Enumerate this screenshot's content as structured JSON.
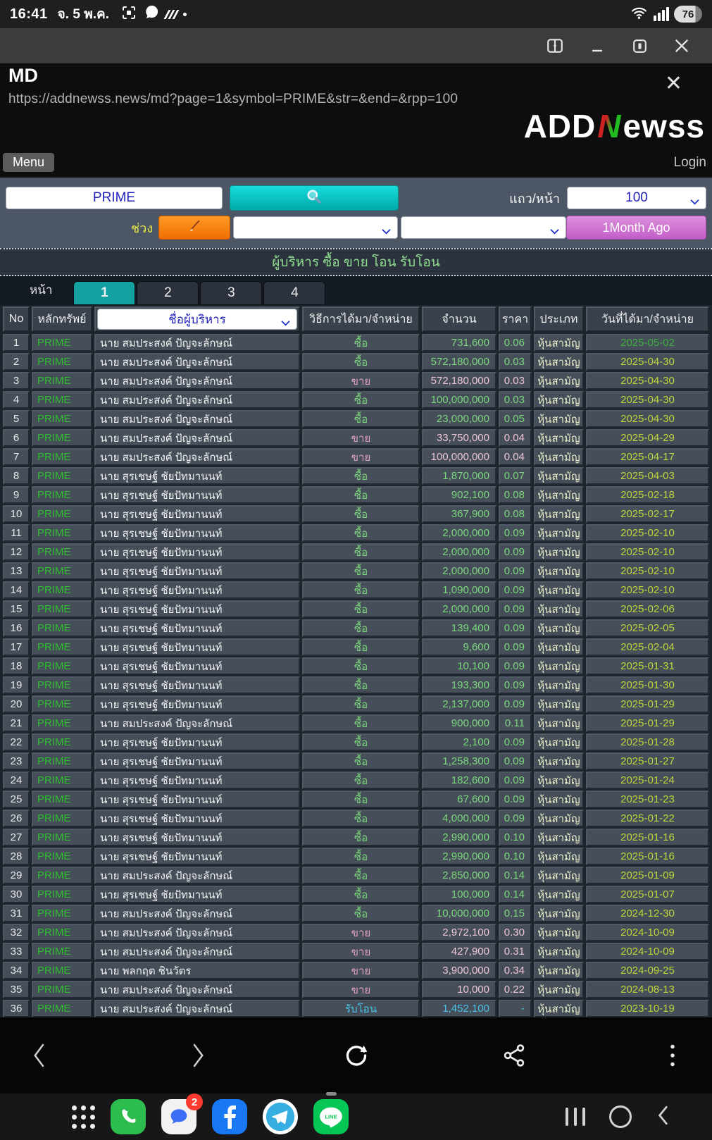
{
  "status_bar": {
    "time": "16:41",
    "date": "จ. 5 พ.ค.",
    "battery": "76"
  },
  "window": {
    "title": "MD",
    "url": "https://addnewss.news/md?page=1&symbol=PRIME&str=&end=&rpp=100"
  },
  "brand": {
    "logo_part1": "ADD",
    "logo_part2": "N",
    "logo_part3": "ewss",
    "menu": "Menu",
    "login": "Login"
  },
  "filters": {
    "symbol_value": "PRIME",
    "rows_per_page_label": "แถว/หน้า",
    "rows_per_page_value": "100",
    "range_label": "ช่วง",
    "month_button": "1Month Ago"
  },
  "table": {
    "title": "ผู้บริหาร ซื้อ ขาย โอน รับโอน",
    "page_label": "หน้า",
    "pages": [
      "1",
      "2",
      "3",
      "4"
    ],
    "active_index": 0,
    "headers": {
      "no": "No",
      "symbol": "หลักทรัพย์",
      "name": "ชื่อผู้บริหาร",
      "method": "วิธีการได้มา/จำหน่าย",
      "amount": "จำนวน",
      "price": "ราคา",
      "type": "ประเภท",
      "date": "วันที่ได้มา/จำหน่าย"
    },
    "rows": [
      {
        "no": "1",
        "symbol": "PRIME",
        "name": "นาย สมประสงค์ ปัญจะลักษณ์",
        "action": "ซื้อ",
        "side": "buy",
        "qty": "731,600",
        "price": "0.06",
        "type": "หุ้นสามัญ",
        "date": "2025-05-02",
        "hl": true
      },
      {
        "no": "2",
        "symbol": "PRIME",
        "name": "นาย สมประสงค์ ปัญจะลักษณ์",
        "action": "ซื้อ",
        "side": "buy",
        "qty": "572,180,000",
        "price": "0.03",
        "type": "หุ้นสามัญ",
        "date": "2025-04-30"
      },
      {
        "no": "3",
        "symbol": "PRIME",
        "name": "นาย สมประสงค์ ปัญจะลักษณ์",
        "action": "ขาย",
        "side": "sell",
        "qty": "572,180,000",
        "price": "0.03",
        "type": "หุ้นสามัญ",
        "date": "2025-04-30"
      },
      {
        "no": "4",
        "symbol": "PRIME",
        "name": "นาย สมประสงค์ ปัญจะลักษณ์",
        "action": "ซื้อ",
        "side": "buy",
        "qty": "100,000,000",
        "price": "0.03",
        "type": "หุ้นสามัญ",
        "date": "2025-04-30"
      },
      {
        "no": "5",
        "symbol": "PRIME",
        "name": "นาย สมประสงค์ ปัญจะลักษณ์",
        "action": "ซื้อ",
        "side": "buy",
        "qty": "23,000,000",
        "price": "0.05",
        "type": "หุ้นสามัญ",
        "date": "2025-04-30"
      },
      {
        "no": "6",
        "symbol": "PRIME",
        "name": "นาย สมประสงค์ ปัญจะลักษณ์",
        "action": "ขาย",
        "side": "sell",
        "qty": "33,750,000",
        "price": "0.04",
        "type": "หุ้นสามัญ",
        "date": "2025-04-29"
      },
      {
        "no": "7",
        "symbol": "PRIME",
        "name": "นาย สมประสงค์ ปัญจะลักษณ์",
        "action": "ขาย",
        "side": "sell",
        "qty": "100,000,000",
        "price": "0.04",
        "type": "หุ้นสามัญ",
        "date": "2025-04-17"
      },
      {
        "no": "8",
        "symbol": "PRIME",
        "name": "นาย สุรเชษฐ์ ชัยปัทมานนท์",
        "action": "ซื้อ",
        "side": "buy",
        "qty": "1,870,000",
        "price": "0.07",
        "type": "หุ้นสามัญ",
        "date": "2025-04-03"
      },
      {
        "no": "9",
        "symbol": "PRIME",
        "name": "นาย สุรเชษฐ์ ชัยปัทมานนท์",
        "action": "ซื้อ",
        "side": "buy",
        "qty": "902,100",
        "price": "0.08",
        "type": "หุ้นสามัญ",
        "date": "2025-02-18"
      },
      {
        "no": "10",
        "symbol": "PRIME",
        "name": "นาย สุรเชษฐ์ ชัยปัทมานนท์",
        "action": "ซื้อ",
        "side": "buy",
        "qty": "367,900",
        "price": "0.08",
        "type": "หุ้นสามัญ",
        "date": "2025-02-17"
      },
      {
        "no": "11",
        "symbol": "PRIME",
        "name": "นาย สุรเชษฐ์ ชัยปัทมานนท์",
        "action": "ซื้อ",
        "side": "buy",
        "qty": "2,000,000",
        "price": "0.09",
        "type": "หุ้นสามัญ",
        "date": "2025-02-10"
      },
      {
        "no": "12",
        "symbol": "PRIME",
        "name": "นาย สุรเชษฐ์ ชัยปัทมานนท์",
        "action": "ซื้อ",
        "side": "buy",
        "qty": "2,000,000",
        "price": "0.09",
        "type": "หุ้นสามัญ",
        "date": "2025-02-10"
      },
      {
        "no": "13",
        "symbol": "PRIME",
        "name": "นาย สุรเชษฐ์ ชัยปัทมานนท์",
        "action": "ซื้อ",
        "side": "buy",
        "qty": "2,000,000",
        "price": "0.09",
        "type": "หุ้นสามัญ",
        "date": "2025-02-10"
      },
      {
        "no": "14",
        "symbol": "PRIME",
        "name": "นาย สุรเชษฐ์ ชัยปัทมานนท์",
        "action": "ซื้อ",
        "side": "buy",
        "qty": "1,090,000",
        "price": "0.09",
        "type": "หุ้นสามัญ",
        "date": "2025-02-10"
      },
      {
        "no": "15",
        "symbol": "PRIME",
        "name": "นาย สุรเชษฐ์ ชัยปัทมานนท์",
        "action": "ซื้อ",
        "side": "buy",
        "qty": "2,000,000",
        "price": "0.09",
        "type": "หุ้นสามัญ",
        "date": "2025-02-06"
      },
      {
        "no": "16",
        "symbol": "PRIME",
        "name": "นาย สุรเชษฐ์ ชัยปัทมานนท์",
        "action": "ซื้อ",
        "side": "buy",
        "qty": "139,400",
        "price": "0.09",
        "type": "หุ้นสามัญ",
        "date": "2025-02-05"
      },
      {
        "no": "17",
        "symbol": "PRIME",
        "name": "นาย สุรเชษฐ์ ชัยปัทมานนท์",
        "action": "ซื้อ",
        "side": "buy",
        "qty": "9,600",
        "price": "0.09",
        "type": "หุ้นสามัญ",
        "date": "2025-02-04"
      },
      {
        "no": "18",
        "symbol": "PRIME",
        "name": "นาย สุรเชษฐ์ ชัยปัทมานนท์",
        "action": "ซื้อ",
        "side": "buy",
        "qty": "10,100",
        "price": "0.09",
        "type": "หุ้นสามัญ",
        "date": "2025-01-31"
      },
      {
        "no": "19",
        "symbol": "PRIME",
        "name": "นาย สุรเชษฐ์ ชัยปัทมานนท์",
        "action": "ซื้อ",
        "side": "buy",
        "qty": "193,300",
        "price": "0.09",
        "type": "หุ้นสามัญ",
        "date": "2025-01-30"
      },
      {
        "no": "20",
        "symbol": "PRIME",
        "name": "นาย สุรเชษฐ์ ชัยปัทมานนท์",
        "action": "ซื้อ",
        "side": "buy",
        "qty": "2,137,000",
        "price": "0.09",
        "type": "หุ้นสามัญ",
        "date": "2025-01-29"
      },
      {
        "no": "21",
        "symbol": "PRIME",
        "name": "นาย สมประสงค์ ปัญจะลักษณ์",
        "action": "ซื้อ",
        "side": "buy",
        "qty": "900,000",
        "price": "0.11",
        "type": "หุ้นสามัญ",
        "date": "2025-01-29"
      },
      {
        "no": "22",
        "symbol": "PRIME",
        "name": "นาย สุรเชษฐ์ ชัยปัทมานนท์",
        "action": "ซื้อ",
        "side": "buy",
        "qty": "2,100",
        "price": "0.09",
        "type": "หุ้นสามัญ",
        "date": "2025-01-28"
      },
      {
        "no": "23",
        "symbol": "PRIME",
        "name": "นาย สุรเชษฐ์ ชัยปัทมานนท์",
        "action": "ซื้อ",
        "side": "buy",
        "qty": "1,258,300",
        "price": "0.09",
        "type": "หุ้นสามัญ",
        "date": "2025-01-27"
      },
      {
        "no": "24",
        "symbol": "PRIME",
        "name": "นาย สุรเชษฐ์ ชัยปัทมานนท์",
        "action": "ซื้อ",
        "side": "buy",
        "qty": "182,600",
        "price": "0.09",
        "type": "หุ้นสามัญ",
        "date": "2025-01-24"
      },
      {
        "no": "25",
        "symbol": "PRIME",
        "name": "นาย สุรเชษฐ์ ชัยปัทมานนท์",
        "action": "ซื้อ",
        "side": "buy",
        "qty": "67,600",
        "price": "0.09",
        "type": "หุ้นสามัญ",
        "date": "2025-01-23"
      },
      {
        "no": "26",
        "symbol": "PRIME",
        "name": "นาย สุรเชษฐ์ ชัยปัทมานนท์",
        "action": "ซื้อ",
        "side": "buy",
        "qty": "4,000,000",
        "price": "0.09",
        "type": "หุ้นสามัญ",
        "date": "2025-01-22"
      },
      {
        "no": "27",
        "symbol": "PRIME",
        "name": "นาย สุรเชษฐ์ ชัยปัทมานนท์",
        "action": "ซื้อ",
        "side": "buy",
        "qty": "2,990,000",
        "price": "0.10",
        "type": "หุ้นสามัญ",
        "date": "2025-01-16"
      },
      {
        "no": "28",
        "symbol": "PRIME",
        "name": "นาย สุรเชษฐ์ ชัยปัทมานนท์",
        "action": "ซื้อ",
        "side": "buy",
        "qty": "2,990,000",
        "price": "0.10",
        "type": "หุ้นสามัญ",
        "date": "2025-01-16"
      },
      {
        "no": "29",
        "symbol": "PRIME",
        "name": "นาย สมประสงค์ ปัญจะลักษณ์",
        "action": "ซื้อ",
        "side": "buy",
        "qty": "2,850,000",
        "price": "0.14",
        "type": "หุ้นสามัญ",
        "date": "2025-01-09"
      },
      {
        "no": "30",
        "symbol": "PRIME",
        "name": "นาย สุรเชษฐ์ ชัยปัทมานนท์",
        "action": "ซื้อ",
        "side": "buy",
        "qty": "100,000",
        "price": "0.14",
        "type": "หุ้นสามัญ",
        "date": "2025-01-07"
      },
      {
        "no": "31",
        "symbol": "PRIME",
        "name": "นาย สมประสงค์ ปัญจะลักษณ์",
        "action": "ซื้อ",
        "side": "buy",
        "qty": "10,000,000",
        "price": "0.15",
        "type": "หุ้นสามัญ",
        "date": "2024-12-30"
      },
      {
        "no": "32",
        "symbol": "PRIME",
        "name": "นาย สมประสงค์ ปัญจะลักษณ์",
        "action": "ขาย",
        "side": "sell",
        "qty": "2,972,100",
        "price": "0.30",
        "type": "หุ้นสามัญ",
        "date": "2024-10-09"
      },
      {
        "no": "33",
        "symbol": "PRIME",
        "name": "นาย สมประสงค์ ปัญจะลักษณ์",
        "action": "ขาย",
        "side": "sell",
        "qty": "427,900",
        "price": "0.31",
        "type": "หุ้นสามัญ",
        "date": "2024-10-09"
      },
      {
        "no": "34",
        "symbol": "PRIME",
        "name": "นาย พลกฤต ชินวัตร",
        "action": "ขาย",
        "side": "sell",
        "qty": "3,900,000",
        "price": "0.34",
        "type": "หุ้นสามัญ",
        "date": "2024-09-25"
      },
      {
        "no": "35",
        "symbol": "PRIME",
        "name": "นาย สมประสงค์ ปัญจะลักษณ์",
        "action": "ขาย",
        "side": "sell",
        "qty": "10,000",
        "price": "0.22",
        "type": "หุ้นสามัญ",
        "date": "2024-08-13"
      },
      {
        "no": "36",
        "symbol": "PRIME",
        "name": "นาย สมประสงค์ ปัญจะลักษณ์",
        "action": "รับโอน",
        "side": "transfer",
        "qty": "1,452,100",
        "price": "-",
        "type": "หุ้นสามัญ",
        "date": "2023-10-19"
      }
    ]
  },
  "dock": {
    "messages_badge": "2",
    "line_label": "LINE"
  },
  "colors": {
    "accent_teal": "#12a0a0",
    "accent_purple": "#c25ec8",
    "accent_orange": "#ef6f00",
    "buy_green": "#7cd87c",
    "sell_pink": "#e3a3bf",
    "transfer_cyan": "#49c3e8",
    "date_yellow": "#bfd63a",
    "symbol_green": "#2fbe2f"
  }
}
